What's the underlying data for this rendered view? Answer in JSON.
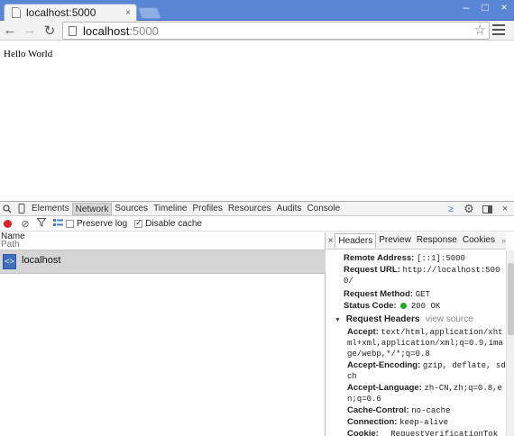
{
  "browser": {
    "tab_title": "localhost:5000",
    "tab_close": "×",
    "window_controls": {
      "minimize": "–",
      "maximize": "□",
      "close": "×"
    },
    "url_host": "localhost",
    "url_port": ":5000",
    "back_icon": "←",
    "forward_icon": "→",
    "reload_icon": "↻",
    "star_icon": "☆"
  },
  "page": {
    "text": "Hello World"
  },
  "devtools": {
    "tabs": [
      "Elements",
      "Network",
      "Sources",
      "Timeline",
      "Profiles",
      "Resources",
      "Audits",
      "Console"
    ],
    "active_tab": "Network",
    "preserve_log_label": "Preserve log",
    "preserve_log_checked": false,
    "disable_cache_label": "Disable cache",
    "disable_cache_checked": true,
    "column_name": "Name",
    "column_path": "Path",
    "requests": [
      {
        "name": "localhost"
      }
    ],
    "detail_tabs": [
      "Headers",
      "Preview",
      "Response",
      "Cookies"
    ],
    "active_detail_tab": "Headers",
    "general": {
      "remote_address_key": "Remote Address:",
      "remote_address": "[::1]:5000",
      "request_url_key": "Request URL:",
      "request_url": "http://localhost:5000/",
      "request_method_key": "Request Method:",
      "request_method": "GET",
      "status_code_key": "Status Code:",
      "status_code": "200 OK",
      "status_color": "#22aa22"
    },
    "request_headers_title": "Request Headers",
    "view_source": "view source",
    "request_headers": [
      {
        "key": "Accept:",
        "value": "text/html,application/xhtml+xml,application/xml;q=0.9,image/webp,*/*;q=0.8"
      },
      {
        "key": "Accept-Encoding:",
        "value": "gzip, deflate, sdch"
      },
      {
        "key": "Accept-Language:",
        "value": "zh-CN,zh;q=0.8,en;q=0.6"
      },
      {
        "key": "Cache-Control:",
        "value": "no-cache"
      },
      {
        "key": "Connection:",
        "value": "keep-alive"
      },
      {
        "key": "Cookie:",
        "value": "__RequestVerificationTok"
      }
    ]
  },
  "colors": {
    "tabstrip": "#5a86d6",
    "record_button": "#dd2222",
    "selected_row": "#d5d5d5"
  }
}
